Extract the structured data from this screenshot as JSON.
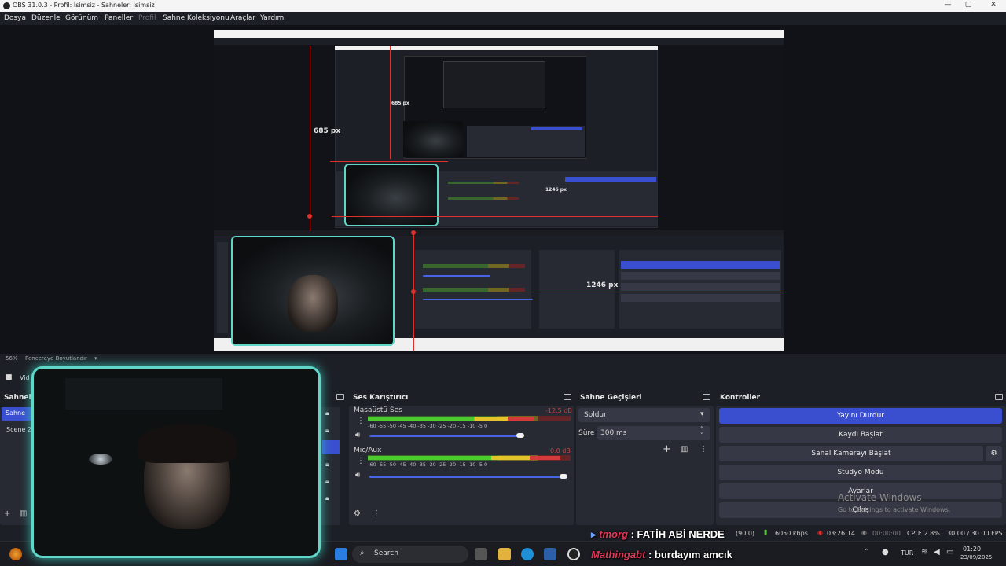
{
  "window": {
    "title": "OBS 31.0.3 - Profil: İsimsiz - Sahneler: İsimsiz",
    "controls": [
      "—",
      "▢",
      "✕"
    ]
  },
  "menu": {
    "items": [
      "Dosya",
      "Düzenle",
      "Görünüm",
      "Paneller",
      "Profil",
      "Sahne Koleksiyonu",
      "Araçlar",
      "Yardım"
    ]
  },
  "preview": {
    "height_label": "685 px",
    "width_label": "1246 px",
    "inner_height_label": "685 px",
    "inner_width_label": "1246 px"
  },
  "zoom": {
    "value": "56%",
    "mode": "Pencereye Boyutlandır"
  },
  "scenes": {
    "title": "Sahneler",
    "items": [
      "Sahne",
      "Scene 2"
    ],
    "selected": 0
  },
  "sources": {
    "title": "Vid"
  },
  "audio_mixer": {
    "title": "Ses Karıştırıcı",
    "tick_labels": "-60  -55  -50  -45  -40  -35  -30  -25  -20  -15  -10   -5    0",
    "channels": [
      {
        "name": "Masaüstü Ses",
        "db": "-12.5 dB",
        "level": 0.82,
        "volume": 0.78
      },
      {
        "name": "Mic/Aux",
        "db": "0.0 dB",
        "level": 0.95,
        "volume": 1.0
      }
    ]
  },
  "transitions": {
    "title": "Sahne Geçişleri",
    "selected": "Soldur",
    "duration_label": "Süre",
    "duration_value": "300 ms"
  },
  "controls": {
    "title": "Kontroller",
    "buttons": [
      "Yayını Durdur",
      "Kaydı Başlat",
      "Sanal Kamerayı Başlat",
      "Stüdyo Modu",
      "Ayarlar",
      "Çıkış"
    ]
  },
  "activation": {
    "title": "Activate Windows",
    "subtitle": "Go to Settings to activate Windows."
  },
  "status": {
    "frames": "(90.0)",
    "bitrate": "6050 kbps",
    "stream_time": "03:26:14",
    "rec_time": "00:00:00",
    "cpu": "CPU: 2.8%",
    "fps": "30.00 / 30.00 FPS"
  },
  "taskbar": {
    "search_placeholder": "Search",
    "lang": "TUR",
    "time": "01:20",
    "date": "23/09/2025"
  },
  "chat": [
    {
      "user": "tmorg",
      "message": ": FATİH ABİ NERDE"
    },
    {
      "user": "Mathingabt",
      "message": ": burdayım amcık"
    }
  ],
  "colors": {
    "accent": "#3a4fd0",
    "webcam_border": "#5fd6c8",
    "selection_red": "#e0302b",
    "chat_user": "#e03a5a"
  }
}
